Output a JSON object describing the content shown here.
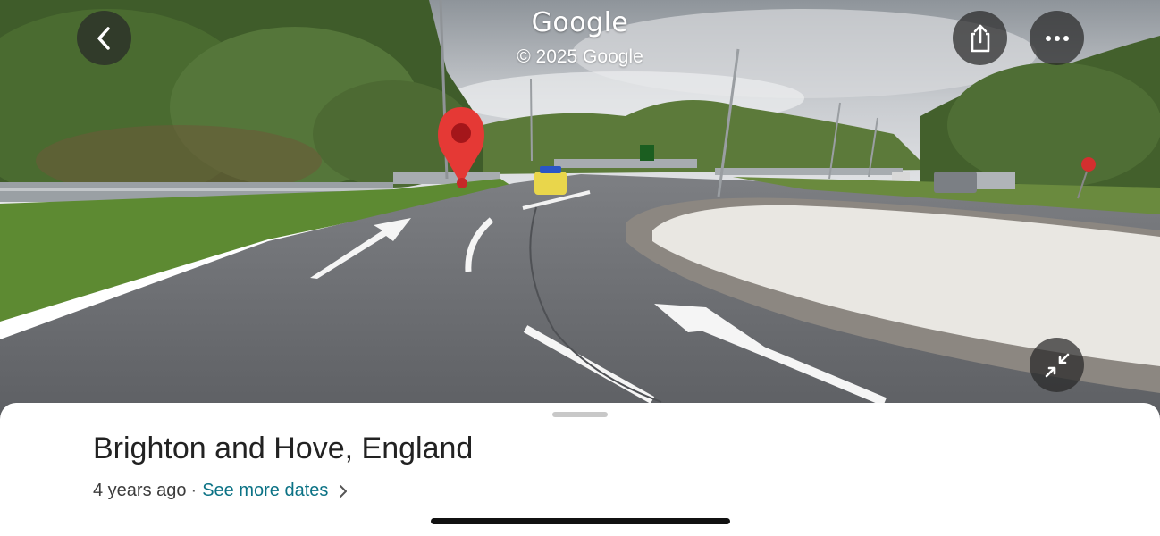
{
  "streetview": {
    "brand": "Google",
    "copyright": "© 2025 Google"
  },
  "buttons": {
    "back_icon": "chevron-left-icon",
    "share_icon": "share-icon",
    "more_icon": "more-horizontal-icon",
    "collapse_icon": "collapse-arrows-icon"
  },
  "place": {
    "title": "Brighton and Hove, England",
    "age": "4 years ago",
    "separator": "·",
    "see_more": "See more dates"
  },
  "colors": {
    "marker": "#e53935",
    "link": "#0b7285"
  }
}
